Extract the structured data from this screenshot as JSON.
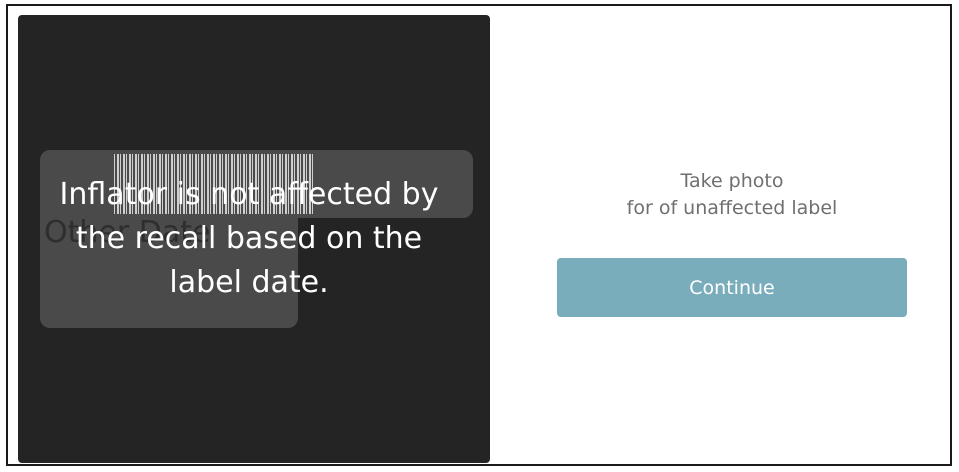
{
  "camera": {
    "label_date_text": "Other Date",
    "message": "Inflator is not affected by the recall based on the label date."
  },
  "instruction": {
    "line1": "Take photo",
    "line2": "for of unaffected label"
  },
  "actions": {
    "continue_label": "Continue",
    "accent_color": "#7aadbc"
  }
}
